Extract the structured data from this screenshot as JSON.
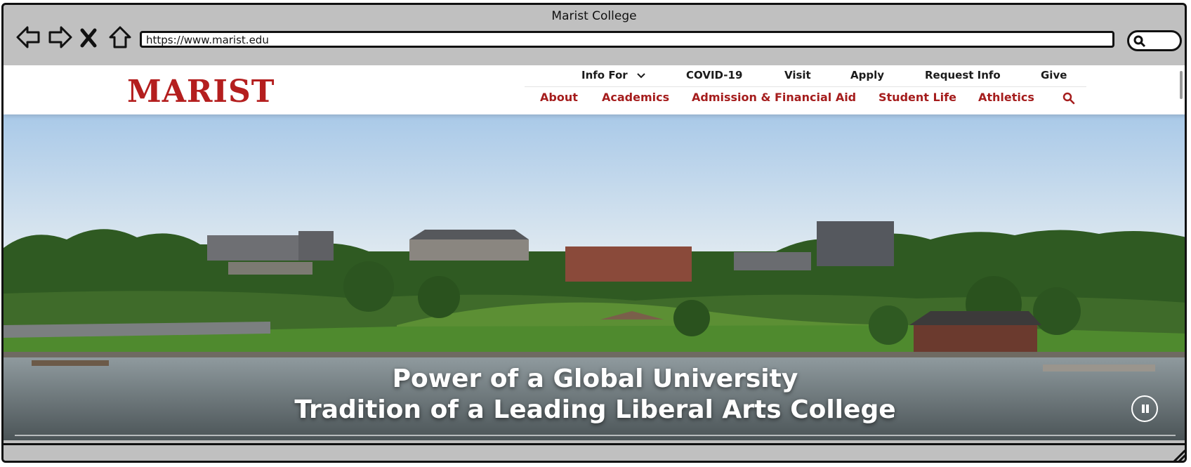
{
  "window": {
    "title": "Marist College",
    "url": "https://www.marist.edu"
  },
  "icons": {
    "back": "back-arrow-icon",
    "forward": "forward-arrow-icon",
    "stop": "close-icon",
    "home": "home-icon",
    "search": "search-icon",
    "chevron": "chevron-down-icon",
    "pause": "pause-icon",
    "resize": "resize-grip-icon"
  },
  "site": {
    "logo": "MARIST",
    "util_nav": [
      "Info For",
      "COVID-19",
      "Visit",
      "Apply",
      "Request Info",
      "Give"
    ],
    "main_nav": [
      "About",
      "Academics",
      "Admission & Financial Aid",
      "Student Life",
      "Athletics"
    ]
  },
  "hero": {
    "line1": "Power of a Global University",
    "line2": "Tradition of a Leading Liberal Arts College"
  },
  "colors": {
    "brand_red": "#b41e1e",
    "nav_red": "#a51d1d",
    "chrome_gray": "#c0c0c0"
  }
}
